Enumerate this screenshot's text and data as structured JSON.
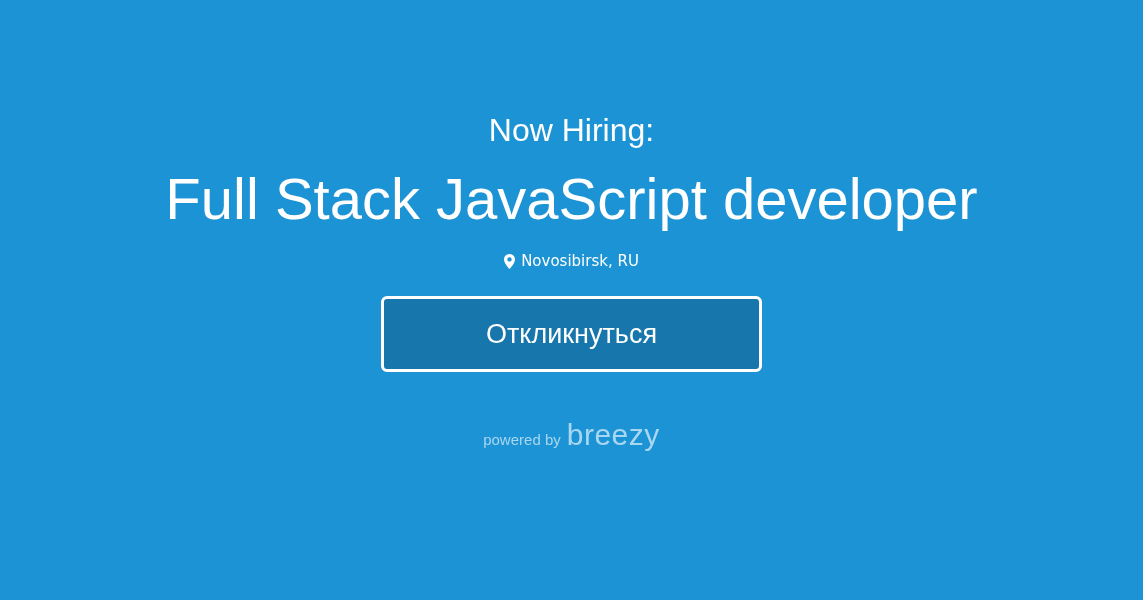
{
  "header": {
    "eyebrow": "Now Hiring:",
    "title": "Full Stack JavaScript developer",
    "location": "Novosibirsk, RU"
  },
  "apply_button": {
    "label": "Откликнуться"
  },
  "footer": {
    "prefix": "powered by",
    "brand": "breezy"
  }
}
